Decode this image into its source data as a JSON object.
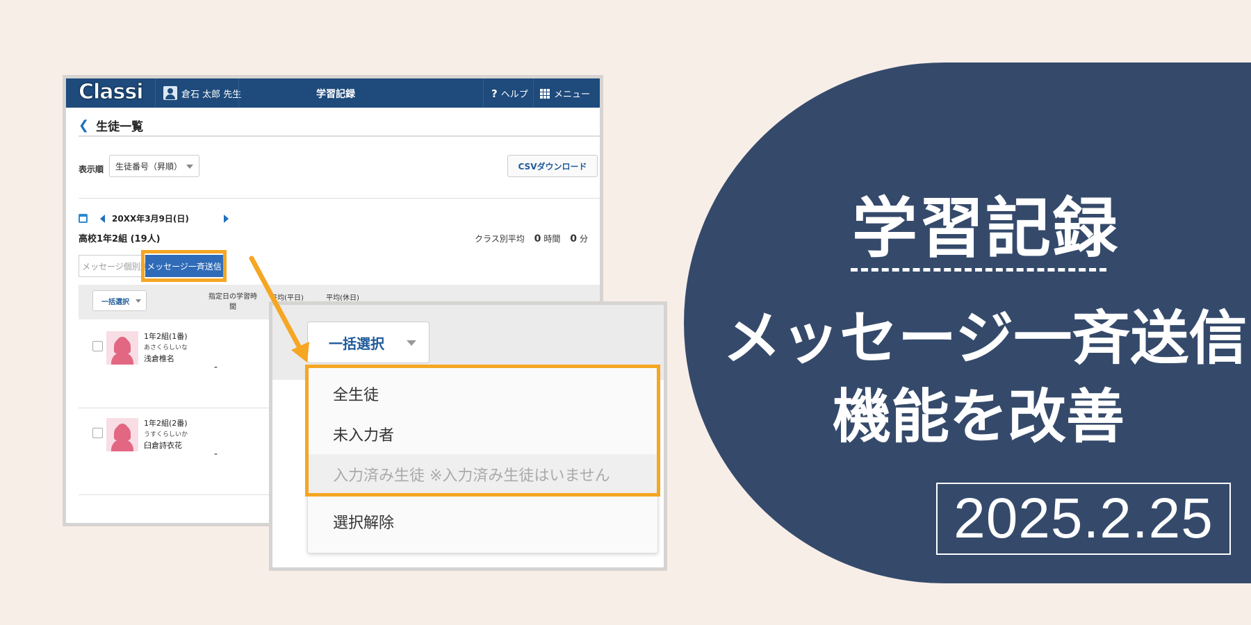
{
  "app": {
    "logo": "Classi",
    "user": "倉石 太郎 先生",
    "header_title": "学習記録",
    "help_label": "ヘルプ",
    "menu_label": "メニュー"
  },
  "page": {
    "title": "生徒一覧",
    "sort_label": "表示順",
    "sort_value": "生徒番号（昇順）",
    "csv_button": "CSVダウンロード",
    "date": "20XX年3月9日(日)",
    "class_name": "高校1年2組 (19人)",
    "class_avg_label": "クラス別平均",
    "class_avg_hours": "0",
    "hours_unit": "時間",
    "class_avg_minutes": "0",
    "minutes_unit": "分",
    "msg_individual": "メッセージ個別送信",
    "msg_bulk": "メッセージ一斉送信"
  },
  "table": {
    "bulk_select": "一括選択",
    "headers": [
      "指定日の学習時間",
      "平均(平日)",
      "平均(休日)"
    ],
    "rows": [
      {
        "class_no": "1年2組(1番)",
        "kana": "あさくらしいな",
        "name": "浅倉椎名",
        "value": "-"
      },
      {
        "class_no": "1年2組(2番)",
        "kana": "うすくらしいか",
        "name": "臼倉詩衣花",
        "value": "-"
      }
    ]
  },
  "dropdown": {
    "button": "一括選択",
    "items": [
      "全生徒",
      "未入力者",
      "入力済み生徒 ※入力済み生徒はいません",
      "選択解除"
    ]
  },
  "banner": {
    "title": "学習記録",
    "subtitle_line1": "メッセージ一斉送信",
    "subtitle_line2": "機能を改善",
    "date": "2025.2.25"
  },
  "colors": {
    "background": "#f8eee8",
    "panel": "#354a6b",
    "header": "#1e4a7c",
    "highlight": "#f5a623",
    "accent_button": "#2f6bb8"
  }
}
